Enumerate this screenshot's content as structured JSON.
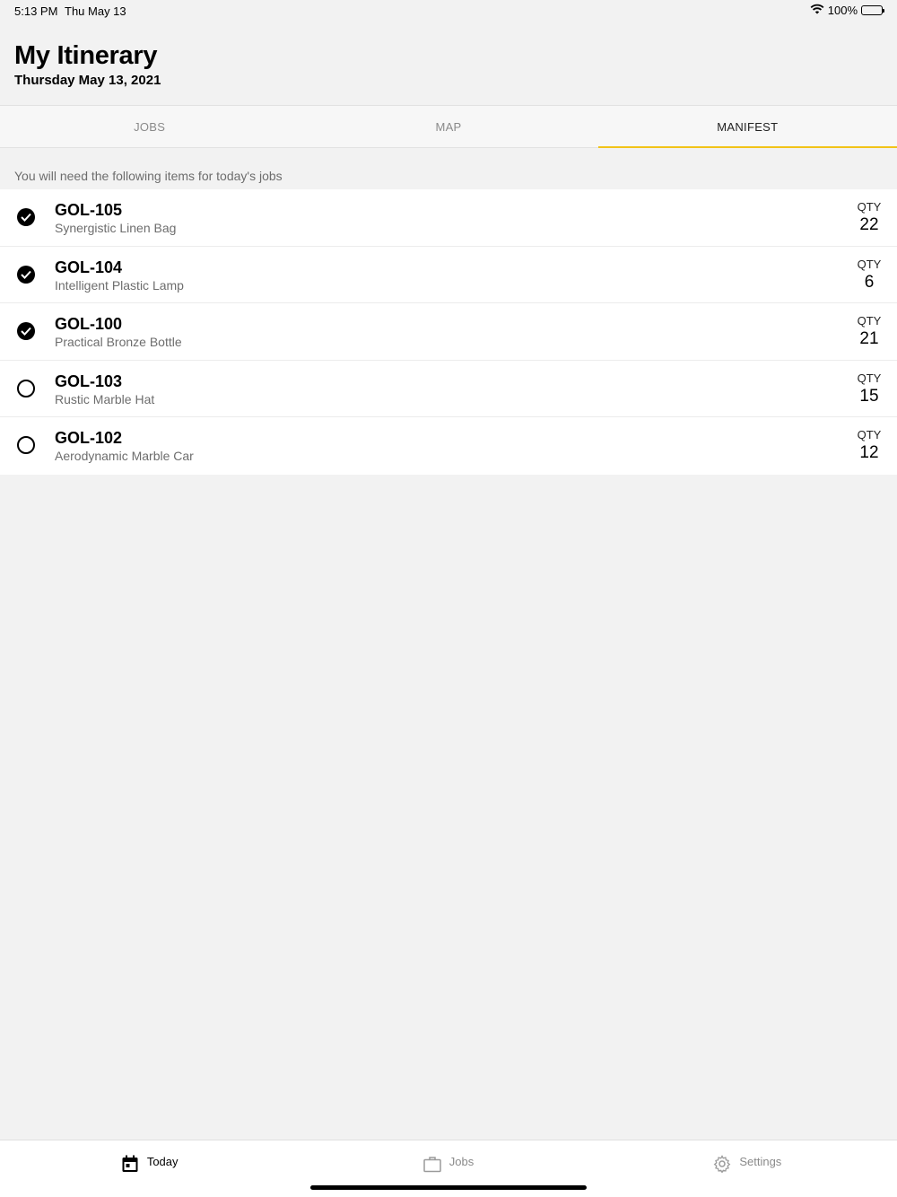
{
  "status_bar": {
    "time": "5:13 PM",
    "date": "Thu May 13",
    "battery": "100%"
  },
  "header": {
    "title": "My Itinerary",
    "subtitle": "Thursday May 13, 2021"
  },
  "tabs": [
    {
      "label": "JOBS",
      "active": false
    },
    {
      "label": "MAP",
      "active": false
    },
    {
      "label": "MANIFEST",
      "active": true
    }
  ],
  "manifest": {
    "intro": "You will need the following items for today's jobs",
    "qty_label": "QTY",
    "items": [
      {
        "code": "GOL-105",
        "name": "Synergistic Linen Bag",
        "qty": "22",
        "checked": true
      },
      {
        "code": "GOL-104",
        "name": "Intelligent Plastic Lamp",
        "qty": "6",
        "checked": true
      },
      {
        "code": "GOL-100",
        "name": "Practical Bronze Bottle",
        "qty": "21",
        "checked": true
      },
      {
        "code": "GOL-103",
        "name": "Rustic Marble Hat",
        "qty": "15",
        "checked": false
      },
      {
        "code": "GOL-102",
        "name": "Aerodynamic Marble Car",
        "qty": "12",
        "checked": false
      }
    ]
  },
  "tabbar": [
    {
      "label": "Today",
      "icon": "calendar-icon",
      "active": true
    },
    {
      "label": "Jobs",
      "icon": "briefcase-icon",
      "active": false
    },
    {
      "label": "Settings",
      "icon": "gear-icon",
      "active": false
    }
  ],
  "colors": {
    "accent": "#f2c318",
    "background": "#f2f2f2"
  }
}
